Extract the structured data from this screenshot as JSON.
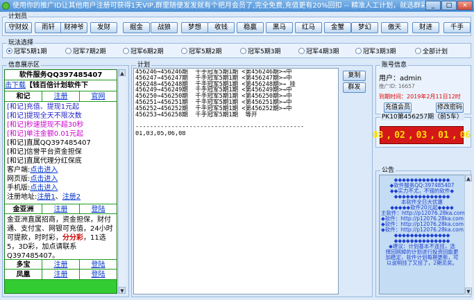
{
  "window": {
    "title": "使用你的推广ID让其他用户注册可获得1天VIP,群里随便发发就有个把月会员了,完全免费,充值更有20%回扣    -- 精准人工计划，就选群彩",
    "controls": [
      "_",
      "□",
      "×"
    ]
  },
  "plan_bar": {
    "title": "计划员",
    "buttons": [
      "守财奴",
      "雨轩",
      "财神爷",
      "发财",
      "掘金",
      "战狼",
      "梦想",
      "收钱",
      "稳赢",
      "黑马",
      "红马",
      "金蟹",
      "梦幻",
      "傲天",
      "财进",
      "千手"
    ]
  },
  "play_mode": {
    "title": "玩法选择",
    "options": [
      "冠军5期1期",
      "冠军7期2期",
      "冠军6期2期",
      "冠军5期2期",
      "冠军5期3期",
      "冠军4期3期",
      "冠军3期3期",
      "全部计划"
    ],
    "selected_index": 0
  },
  "info": {
    "title": "信息展示区",
    "service": "软件服务QQ397485407",
    "download_link": "击下载",
    "banner": "【钱百倍计划软件下",
    "heji": {
      "name": "和记",
      "register": "注册",
      "site": "官网"
    },
    "heji_lines": [
      {
        "text": "[和记]充值、提现1元起",
        "color": "#2020c8"
      },
      {
        "text": "[和记]提现全天不限次数",
        "color": "#2020c8"
      },
      {
        "text": "[和记]秒速提现不超30秒",
        "color": "#cc00cc"
      },
      {
        "text": "[和记]单注金额0.01元起",
        "color": "#cc00cc"
      },
      {
        "text": "[和记]直属QQ397485407",
        "color": "#000000"
      },
      {
        "text": "[和记]信誉平台资金担保",
        "color": "#000000"
      },
      {
        "text": "[和记]直属代理分红保底",
        "color": "#000000"
      }
    ],
    "clients": [
      {
        "label": "客户端:",
        "link": "点击进入"
      },
      {
        "label": "网页版:",
        "link": "点击进入"
      },
      {
        "label": "手机版:",
        "link": "点击进入"
      }
    ],
    "reg_address": {
      "label": "注册地址:",
      "link1": "注册1",
      "sep": "、",
      "link2": "注册2"
    },
    "jyz": {
      "name": "金亚洲",
      "register": "注册",
      "login": "登陆"
    },
    "jyz_desc": "金亚洲直属招商，资金担保，财付通、支付宝、网银可充值，24小时可提款，时时彩，",
    "jyz_fen": "分分彩",
    "jyz_desc2": "，11选5，3D彩，加点请联系Q397485407。",
    "duobao": {
      "name": "多宝",
      "register": "注册",
      "login": "登陆"
    },
    "fenghuang": {
      "name": "凤凰",
      "register": "注册",
      "login": "登陆"
    }
  },
  "plan": {
    "title": "计划",
    "lines": [
      "456246→456246期  千手冠军5期1期 <第456246期>→中",
      "456247→456247期  千手冠军5期1期 <第456247期>→中",
      "456248→456248期  千手冠军5期1期 <第456248期>→ 挂",
      "456249→456249期  千手冠军5期1期 <第456249期>→中",
      "456250→456250期  千手冠军5期1期 <第456250期>→中",
      "456251→456251期  千手冠军5期1期 <第456251期>→中",
      "456252→456252期  千手冠军5期1期 <第456252期>→中",
      "456253→456258期  千手冠军5期1期  等开"
    ],
    "dashes": "-----------------------------------------------",
    "numbers": "01,03,05,06,08",
    "copy_button": "复制",
    "group_button": "群发"
  },
  "account": {
    "title": "账号信息",
    "user_label": "用户：",
    "username": "admin",
    "promo_id": "推广ID: 16657",
    "expire": "到期时间：2019年2月11日12时",
    "recharge_button": "充值会员",
    "change_pwd_button": "修改密码"
  },
  "lottery": {
    "title": "PK10第456257期（前5车）",
    "numbers": [
      "08",
      "02",
      "03",
      "01",
      "06"
    ]
  },
  "notice": {
    "title": "公告",
    "lines": [
      "◆◆◆◆◆◆◆◆◆◆◆◆◆◆",
      "◆软件服务QQ:397485407",
      "◆◆实力不尤，不错的软件◆",
      "◆◆◆◆◆◆◆◆◆◆◆◆◆◆",
      "本软件全日大优惠",
      "◆◆◆◆◆软件20元起◆◆◆◆",
      "主软件：http://p12076.28ka.com",
      "◆软件：http://p12076.28ka.com",
      "◆软件：http://p12076.28ka.com",
      "◆软件：http://p12076.28ka.com",
      "◆◆◆◆◆◆◆◆◆◆◆◆◆◆",
      "◆◆◆◆◆◆◆◆◆◆◆◆◆◆",
      "◆建议：计划基本不连挂，选",
      "择回网掉的计划进行投资回能更",
      "加稳定，软件计划每期更新，可",
      "以说明挂了又挂了，2期见奖。"
    ]
  }
}
